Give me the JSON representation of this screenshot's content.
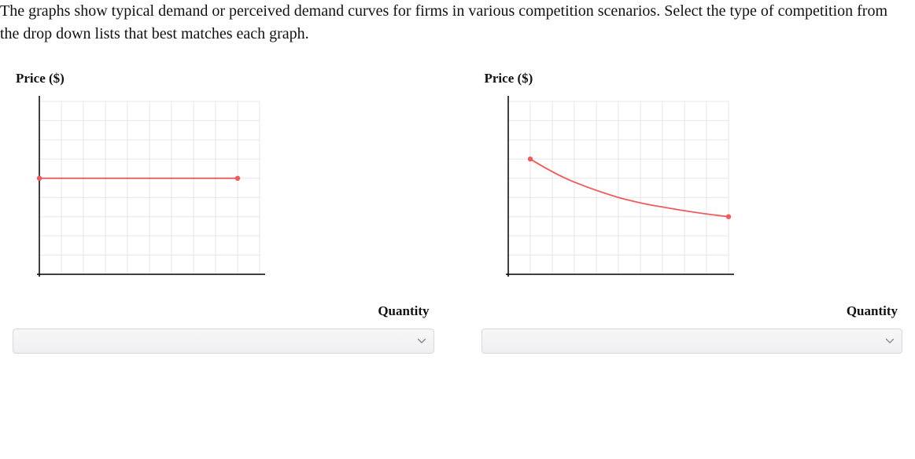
{
  "prompt": "The graphs show typical demand or perceived demand curves for firms in various competition scenarios. Select the type of competition from the drop down lists that best matches each graph.",
  "charts": [
    {
      "y_label": "Price ($)",
      "x_label": "Quantity",
      "dropdown_value": "",
      "grid": {
        "cols": 10,
        "rows": 9
      }
    },
    {
      "y_label": "Price ($)",
      "x_label": "Quantity",
      "dropdown_value": "",
      "grid": {
        "cols": 10,
        "rows": 9
      }
    }
  ],
  "colors": {
    "grid": "#e7e7ea",
    "axis": "#000000",
    "curve": "#f05a5a"
  },
  "chart_data": [
    {
      "type": "line",
      "title": "",
      "xlabel": "Quantity",
      "ylabel": "Price ($)",
      "xlim": [
        0,
        10
      ],
      "ylim": [
        0,
        9
      ],
      "series": [
        {
          "name": "Demand",
          "points": [
            [
              0,
              5
            ],
            [
              9,
              5
            ]
          ]
        }
      ]
    },
    {
      "type": "line",
      "title": "",
      "xlabel": "Quantity",
      "ylabel": "Price ($)",
      "xlim": [
        0,
        10
      ],
      "ylim": [
        0,
        9
      ],
      "series": [
        {
          "name": "Demand",
          "points": [
            [
              1,
              6
            ],
            [
              3,
              4.8
            ],
            [
              5,
              4.0
            ],
            [
              7,
              3.5
            ],
            [
              10,
              3.0
            ]
          ]
        }
      ]
    }
  ]
}
